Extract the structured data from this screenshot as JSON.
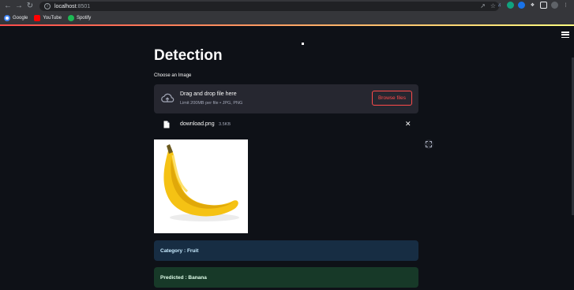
{
  "browser": {
    "url_host": "localhost",
    "url_port": ":8501",
    "bookmarks": [
      {
        "label": "Google",
        "color": "#ffffff"
      },
      {
        "label": "YouTube",
        "color": "#ff0000"
      },
      {
        "label": "Spotify",
        "color": "#1db954"
      }
    ]
  },
  "page": {
    "title": "Detection",
    "uploader": {
      "label": "Choose an Image",
      "dropzone_title": "Drag and drop file here",
      "dropzone_limit": "Limit 200MB per file • JPG, PNG",
      "browse_label": "Browse files"
    },
    "file": {
      "name": "download.png",
      "size": "3.5KB"
    },
    "category_text": "Category : Fruit",
    "predicted_text": "Predicted : Banana"
  },
  "colors": {
    "background": "#0e1117",
    "accent": "#ff4b4b",
    "info_bg": "#172d43",
    "success_bg": "#173928"
  },
  "icons": [
    "back-icon",
    "forward-icon",
    "reload-icon",
    "info-icon",
    "share-icon",
    "star-icon",
    "menu-icon",
    "upload-cloud-icon",
    "file-icon",
    "close-icon",
    "fullscreen-icon"
  ]
}
